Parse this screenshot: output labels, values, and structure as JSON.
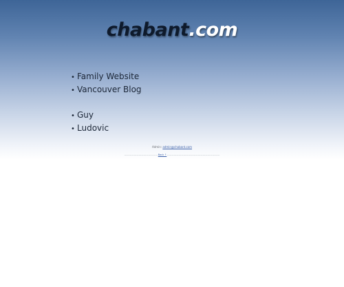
{
  "header": {
    "logo_name": "chabant",
    "logo_tld": ".com"
  },
  "sites": [
    {
      "label": "Family Website"
    },
    {
      "label": "Vancouver Blog"
    }
  ],
  "people": [
    {
      "label": "Guy"
    },
    {
      "label": "Ludovic"
    }
  ],
  "list_bullet": "•",
  "footer": {
    "prefix": "Admin:",
    "contact_link": "admin@chabant.com",
    "line2_prefix": "——————————————",
    "line2_link": "Back ↑",
    "line2_suffix": "——————————————————————"
  },
  "colors": {
    "banner_top": "#3e6597",
    "banner_bottom": "#ffffff",
    "text": "#1c2738",
    "logo_tld": "#ffffff"
  }
}
